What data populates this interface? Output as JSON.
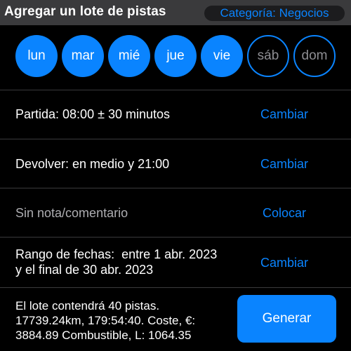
{
  "header": {
    "title": "Agregar un lote de pistas",
    "category": "Categoría: Negocios"
  },
  "days": [
    {
      "label": "lun",
      "selected": true
    },
    {
      "label": "mar",
      "selected": true
    },
    {
      "label": "mié",
      "selected": true
    },
    {
      "label": "jue",
      "selected": true
    },
    {
      "label": "vie",
      "selected": true
    },
    {
      "label": "sáb",
      "selected": false
    },
    {
      "label": "dom",
      "selected": false
    }
  ],
  "departure": {
    "label": "Partida: 08:00 ± 30 minutos",
    "action": "Cambiar"
  },
  "return": {
    "label": "Devolver: en medio y 21:00",
    "action": "Cambiar"
  },
  "note": {
    "label": "Sin nota/comentario",
    "action": "Colocar"
  },
  "date_range": {
    "line1": "Rango de fechas:  entre 1 abr. 2023",
    "line2": "y el final de 30 abr. 2023",
    "action": "Cambiar"
  },
  "summary": {
    "line1": "El lote contendrá 40 pistas.",
    "line2": "17739.24km, 179:54:40. Coste, €:",
    "line3": "3884.89 Combustible, L: 1064.35"
  },
  "generate_button": "Generar",
  "colors": {
    "accent": "#0a84ff",
    "background": "#000000",
    "header": "#3a3a3c"
  }
}
